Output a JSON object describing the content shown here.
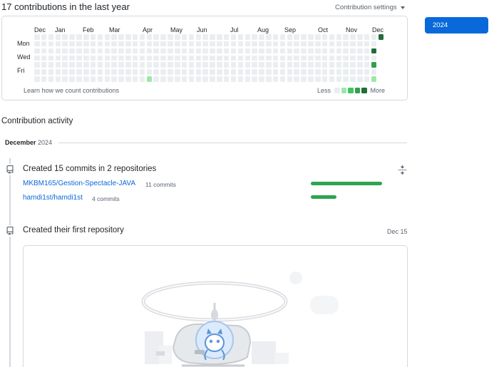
{
  "header": {
    "contributions_title": "17 contributions in the last year",
    "settings_label": "Contribution settings"
  },
  "year_selector": {
    "selected": "2024"
  },
  "calendar": {
    "months": [
      "Dec",
      "Jan",
      "Feb",
      "Mar",
      "Apr",
      "May",
      "Jun",
      "Jul",
      "Aug",
      "Sep",
      "Oct",
      "Nov",
      "Dec"
    ],
    "day_labels": [
      "Mon",
      "Wed",
      "Fri"
    ],
    "learn_link": "Learn how we count contributions",
    "legend_less": "Less",
    "legend_more": "More",
    "level_colors": [
      "#ebeef1",
      "#9be9a8",
      "#40c463",
      "#30a14e",
      "#216e39"
    ],
    "contribution_days": [
      {
        "week": 16,
        "weekday": 6,
        "level": 1
      },
      {
        "week": 49,
        "weekday": 0,
        "level": 4
      },
      {
        "week": 48,
        "weekday": 2,
        "level": 4
      },
      {
        "week": 48,
        "weekday": 4,
        "level": 3
      },
      {
        "week": 48,
        "weekday": 6,
        "level": 1
      }
    ]
  },
  "activity": {
    "title": "Contribution activity",
    "month_name": "December",
    "year": "2024",
    "events": [
      {
        "title": "Created 15 commits in 2 repositories",
        "repos": [
          {
            "name": "MKBM165/Gestion-Spectacle-JAVA",
            "count": "11 commits",
            "share": 1.0
          },
          {
            "name": "hamdi1st/hamdi1st",
            "count": "4 commits",
            "share": 0.36
          }
        ]
      },
      {
        "title": "Created their first repository",
        "date": "Dec 15"
      }
    ]
  }
}
